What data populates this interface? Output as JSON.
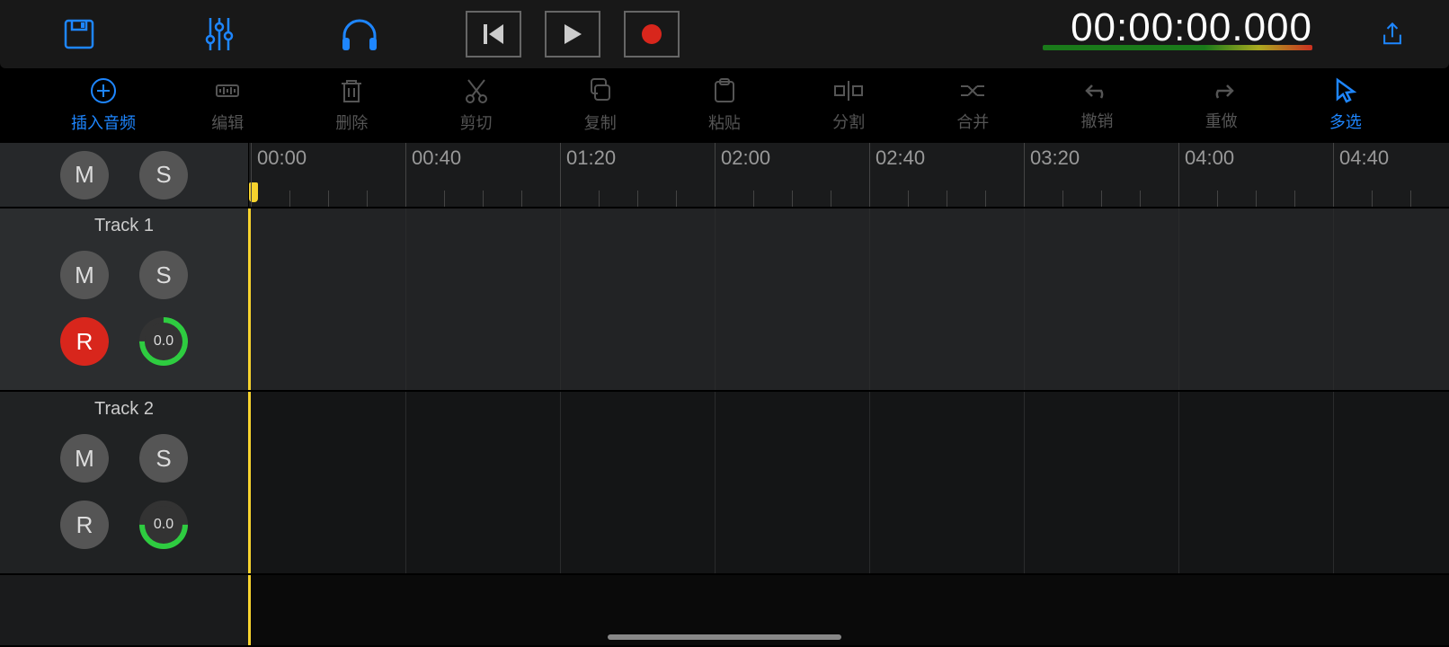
{
  "transport": {
    "timer": "00:00:00.000"
  },
  "tools": [
    {
      "label": "插入音频",
      "active": true
    },
    {
      "label": "编辑",
      "active": false
    },
    {
      "label": "删除",
      "active": false
    },
    {
      "label": "剪切",
      "active": false
    },
    {
      "label": "复制",
      "active": false
    },
    {
      "label": "粘贴",
      "active": false
    },
    {
      "label": "分割",
      "active": false
    },
    {
      "label": "合并",
      "active": false
    },
    {
      "label": "撤销",
      "active": false
    },
    {
      "label": "重做",
      "active": false
    },
    {
      "label": "多选",
      "active": true
    }
  ],
  "ruler": {
    "mute": "M",
    "solo": "S",
    "ticks": [
      "00:00",
      "00:40",
      "01:20",
      "02:00",
      "02:40",
      "03:20",
      "04:00",
      "04:40"
    ]
  },
  "tracks": [
    {
      "name": "Track 1",
      "mute": "M",
      "solo": "S",
      "rec": "R",
      "rec_armed": true,
      "gain": "0.0"
    },
    {
      "name": "Track 2",
      "mute": "M",
      "solo": "S",
      "rec": "R",
      "rec_armed": false,
      "gain": "0.0"
    }
  ]
}
